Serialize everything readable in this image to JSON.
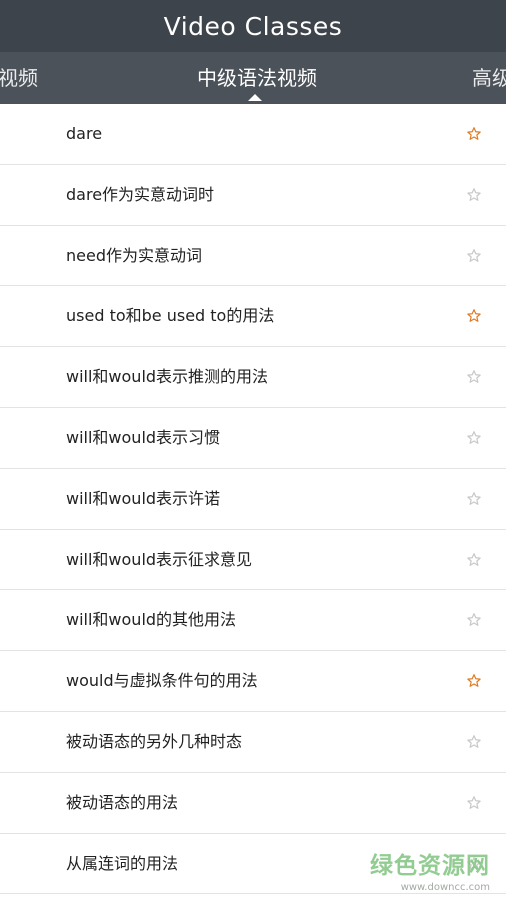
{
  "header": {
    "title": "Video Classes"
  },
  "tabs": {
    "left_label": "视频",
    "center_label": "中级语法视频",
    "right_label": "高级"
  },
  "colors": {
    "title_bar": "#3e444b",
    "tab_bar": "#4c5259",
    "star_active": "#e07b23",
    "star_inactive": "#c8c8c8"
  },
  "list": {
    "items": [
      {
        "label": "dare",
        "starred": true
      },
      {
        "label": "dare作为实意动词时",
        "starred": false
      },
      {
        "label": "need作为实意动词",
        "starred": false
      },
      {
        "label": "used to和be used to的用法",
        "starred": true
      },
      {
        "label": "will和would表示推测的用法",
        "starred": false
      },
      {
        "label": "will和would表示习惯",
        "starred": false
      },
      {
        "label": "will和would表示许诺",
        "starred": false
      },
      {
        "label": "will和would表示征求意见",
        "starred": false
      },
      {
        "label": "will和would的其他用法",
        "starred": false
      },
      {
        "label": "would与虚拟条件句的用法",
        "starred": true
      },
      {
        "label": "被动语态的另外几种时态",
        "starred": false
      },
      {
        "label": "被动语态的用法",
        "starred": false
      },
      {
        "label": "从属连词的用法",
        "starred": false
      }
    ]
  },
  "watermark": {
    "main": "绿色资源网",
    "url": "www.downcc.com"
  }
}
